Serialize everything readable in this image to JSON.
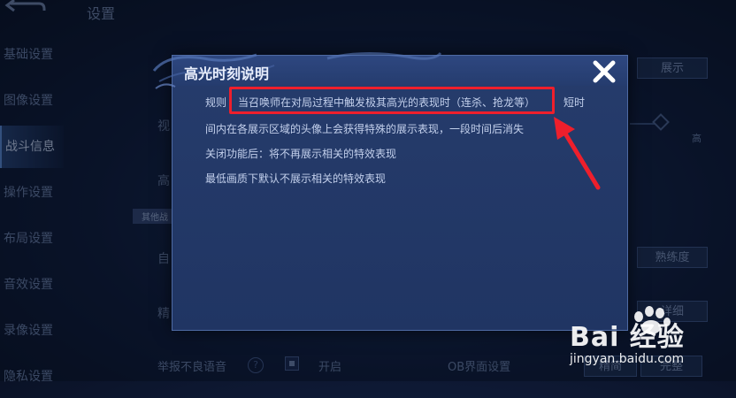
{
  "page": {
    "title": "设置"
  },
  "sidebar": {
    "items": [
      {
        "label": "基础设置",
        "active": false
      },
      {
        "label": "图像设置",
        "active": false
      },
      {
        "label": "战斗信息",
        "active": true
      },
      {
        "label": "操作设置",
        "active": false
      },
      {
        "label": "布局设置",
        "active": false
      },
      {
        "label": "音效设置",
        "active": false
      },
      {
        "label": "录像设置",
        "active": false
      },
      {
        "label": "隐私设置",
        "active": false
      }
    ]
  },
  "background": {
    "show_button": "展示",
    "high_label": "高",
    "proficiency_button": "熟练度",
    "detail_button": "详细",
    "other_tag": "其他战",
    "row_labels": [
      "视",
      "高",
      "自",
      "精"
    ],
    "bottom": {
      "report_label": "举报不良语音",
      "on_label": "开启",
      "ob_label": "OB界面设置",
      "simple_button": "精简",
      "complete_button": "完整"
    }
  },
  "dialog": {
    "title": "高光时刻说明",
    "rule_label": "规则",
    "highlighted_text": "当召唤师在对局过程中触发极其高光的表现时（连杀、抢龙等）",
    "rule_tail": "短时",
    "line2": "间内在各展示区域的头像上会获得特殊的展示表现，一段时间后消失",
    "line3": "关闭功能后：将不再展示相关的特效表现",
    "line4": "最低画质下默认不展示相关的特效表现"
  },
  "watermark": {
    "main": "Bai 经验",
    "url": "jingyan.baidu.com"
  },
  "colors": {
    "annotation_red": "#ee1f2c",
    "dialog_bg": "#223765"
  }
}
